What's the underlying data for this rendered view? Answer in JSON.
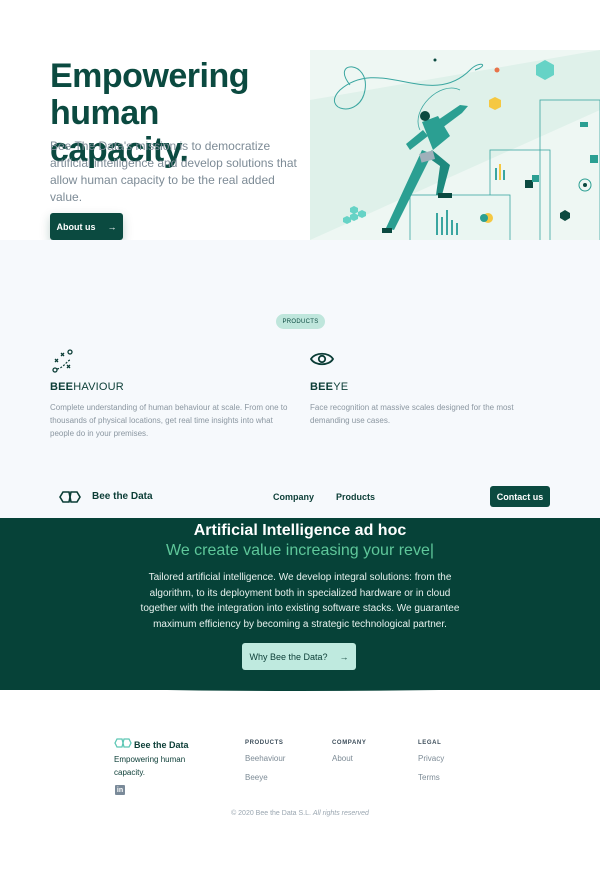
{
  "hero": {
    "title": "Empowering human capacity.",
    "description": "Bee The Data's mission is to democratize artificial intelligence and develop solutions that allow human capacity to be the real added value.",
    "about_button": "About us",
    "arrow": "→"
  },
  "products": {
    "pill": "PRODUCTS",
    "items": [
      {
        "name_bold": "BEE",
        "name_rest": "HAVIOUR",
        "description": "Complete understanding of human behaviour at scale. From one to thousands of physical locations, get real time insights into what people do in your premises.",
        "icon": "strategy-icon"
      },
      {
        "name_bold": "BEE",
        "name_rest": "YE",
        "description": "Face recognition at massive scales designed for the most demanding use cases.",
        "icon": "eye-icon"
      }
    ]
  },
  "navbar": {
    "brand": "Bee the Data",
    "links": [
      "Company",
      "Products"
    ],
    "contact_button": "Contact us"
  },
  "band": {
    "title": "Artificial Intelligence ad hoc",
    "subtitle": "We create value increasing your reve|",
    "text": "Tailored artificial intelligence. We develop integral solutions: from the algorithm, to its deployment both in specialized hardware or in cloud together with the integration into existing software stacks. We guarantee maximum efficiency by becoming a strategic technological partner.",
    "button": "Why Bee the Data?",
    "arrow": "→"
  },
  "footer": {
    "brand": "Bee the Data",
    "tagline": "Empowering human capacity.",
    "linkedin": "in",
    "columns": [
      {
        "heading": "PRODUCTS",
        "links": [
          "Beehaviour",
          "Beeye"
        ]
      },
      {
        "heading": "COMPANY",
        "links": [
          "About"
        ]
      },
      {
        "heading": "LEGAL",
        "links": [
          "Privacy",
          "Terms"
        ]
      }
    ],
    "copyright_main": "© 2020 Bee the Data S.L. ",
    "copyright_italic": "All rights reserved"
  },
  "colors": {
    "primary": "#0b4a40",
    "band": "#064238",
    "accent_green": "#5ec79a",
    "light_teal": "#bfe6dc",
    "background_soft": "#f6f9fc"
  }
}
